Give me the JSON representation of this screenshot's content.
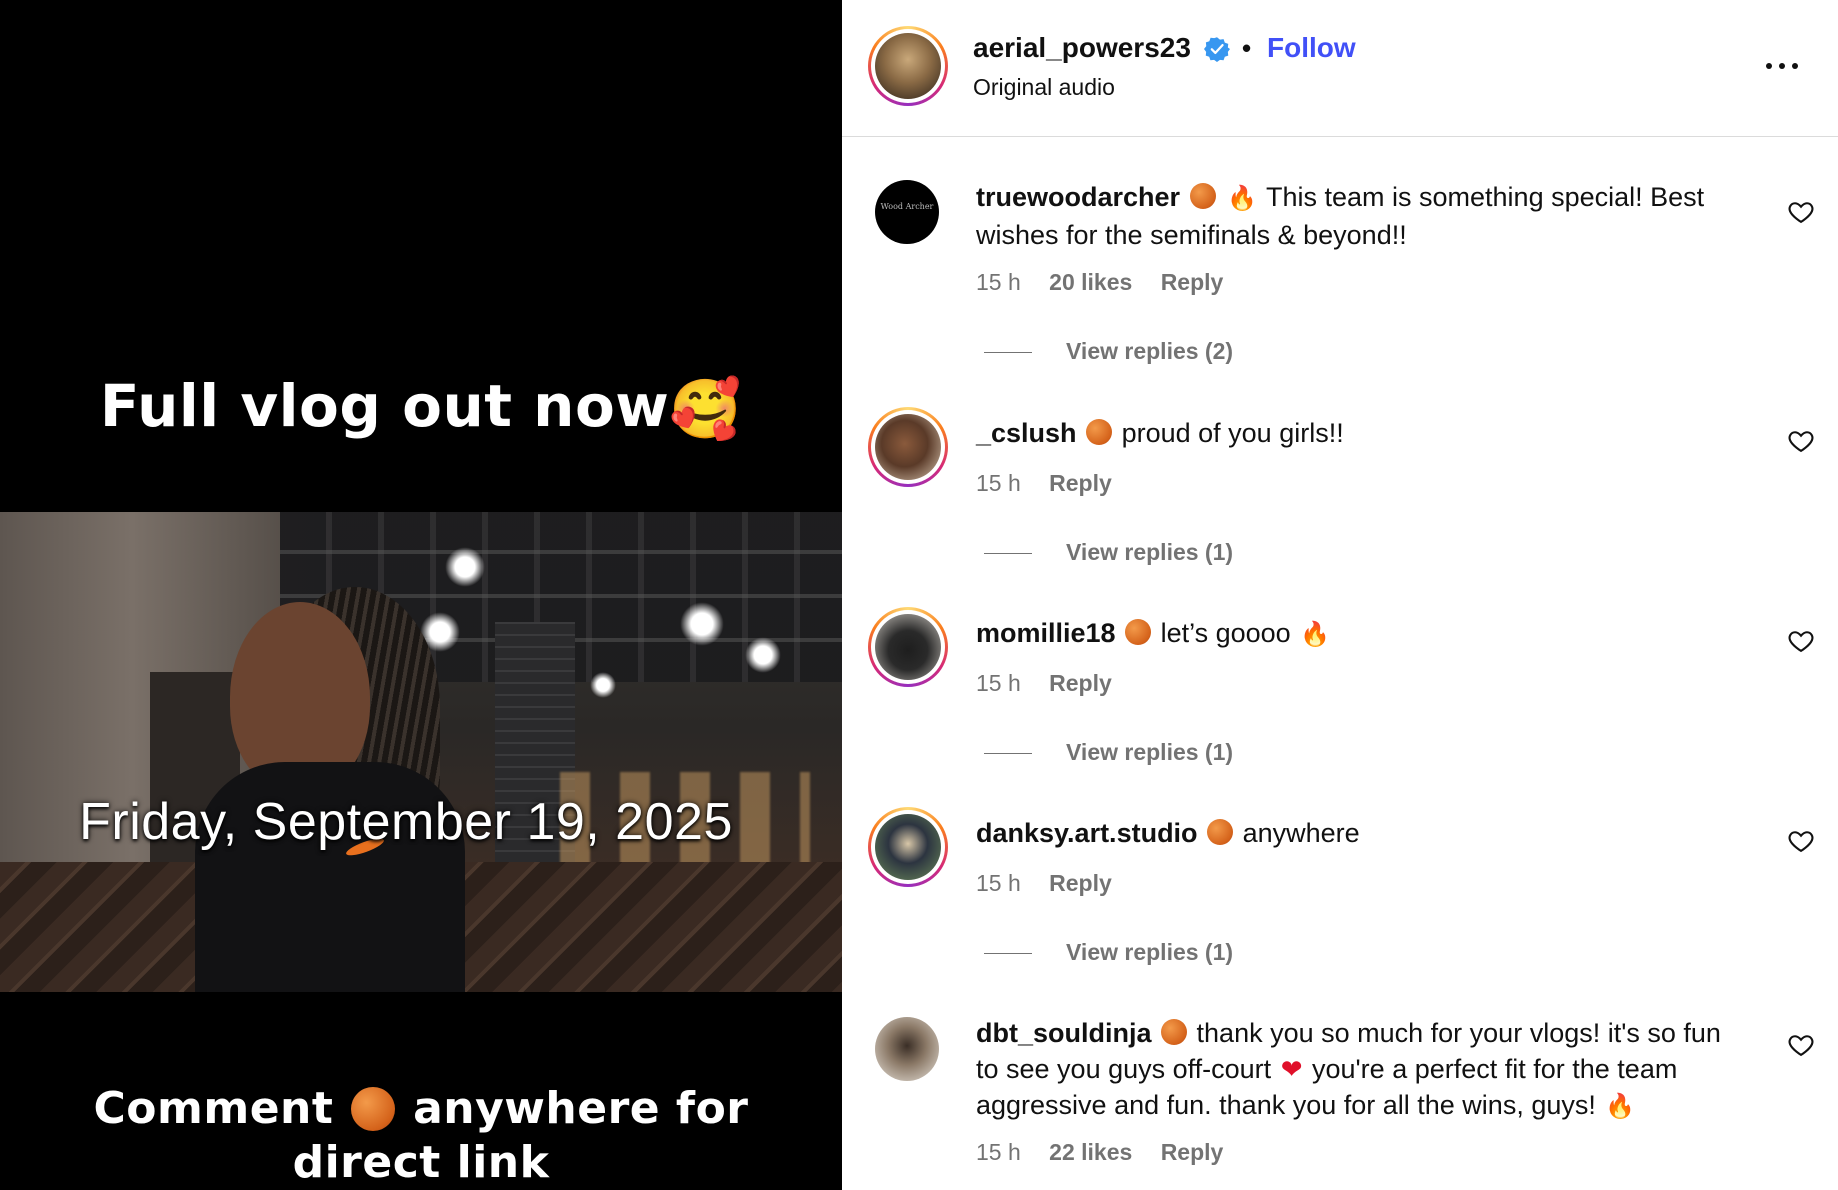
{
  "video": {
    "caption_top": "Full vlog out now",
    "caption_top_emoji": "🥰",
    "date_overlay": "Friday, September 19, 2025",
    "caption_bottom_line1_a": "Comment",
    "caption_bottom_line1_b": "anywhere for",
    "caption_bottom_line2": "direct link"
  },
  "header": {
    "username": "aerial_powers23",
    "separator": "•",
    "follow_label": "Follow",
    "subtitle": "Original audio",
    "verified_icon": "verified-badge-icon",
    "more_icon": "more-options-icon"
  },
  "comments": [
    {
      "user": "truewoodarcher",
      "text": "This team is something special! Best wishes for the semifinals & beyond!!",
      "time": "15 h",
      "likes": "20 likes",
      "reply": "Reply",
      "view_replies": "View replies (2)"
    },
    {
      "user": "_cslush",
      "text": "proud of you girls!!",
      "time": "15 h",
      "reply": "Reply",
      "view_replies": "View replies (1)"
    },
    {
      "user": "momillie18",
      "text": "let’s goooo",
      "time": "15 h",
      "reply": "Reply",
      "view_replies": "View replies (1)"
    },
    {
      "user": "danksy.art.studio",
      "text": "anywhere",
      "time": "15 h",
      "reply": "Reply",
      "view_replies": "View replies (1)"
    },
    {
      "user": "dbt_souldinja",
      "text_a": "thank you so much for your vlogs! it's so fun to see you guys off-court",
      "text_b": "you're a perfect fit for the team aggressive and fun. thank you for all the wins, guys!",
      "time": "15 h",
      "likes": "22 likes",
      "reply": "Reply"
    }
  ],
  "emoji": {
    "fire": "🔥",
    "heart": "❤"
  },
  "avatar_logo_text": "Wood Archer",
  "colors": {
    "follow_blue": "#4150f7",
    "meta_gray": "#737373",
    "verified_blue": "#3897f0"
  }
}
